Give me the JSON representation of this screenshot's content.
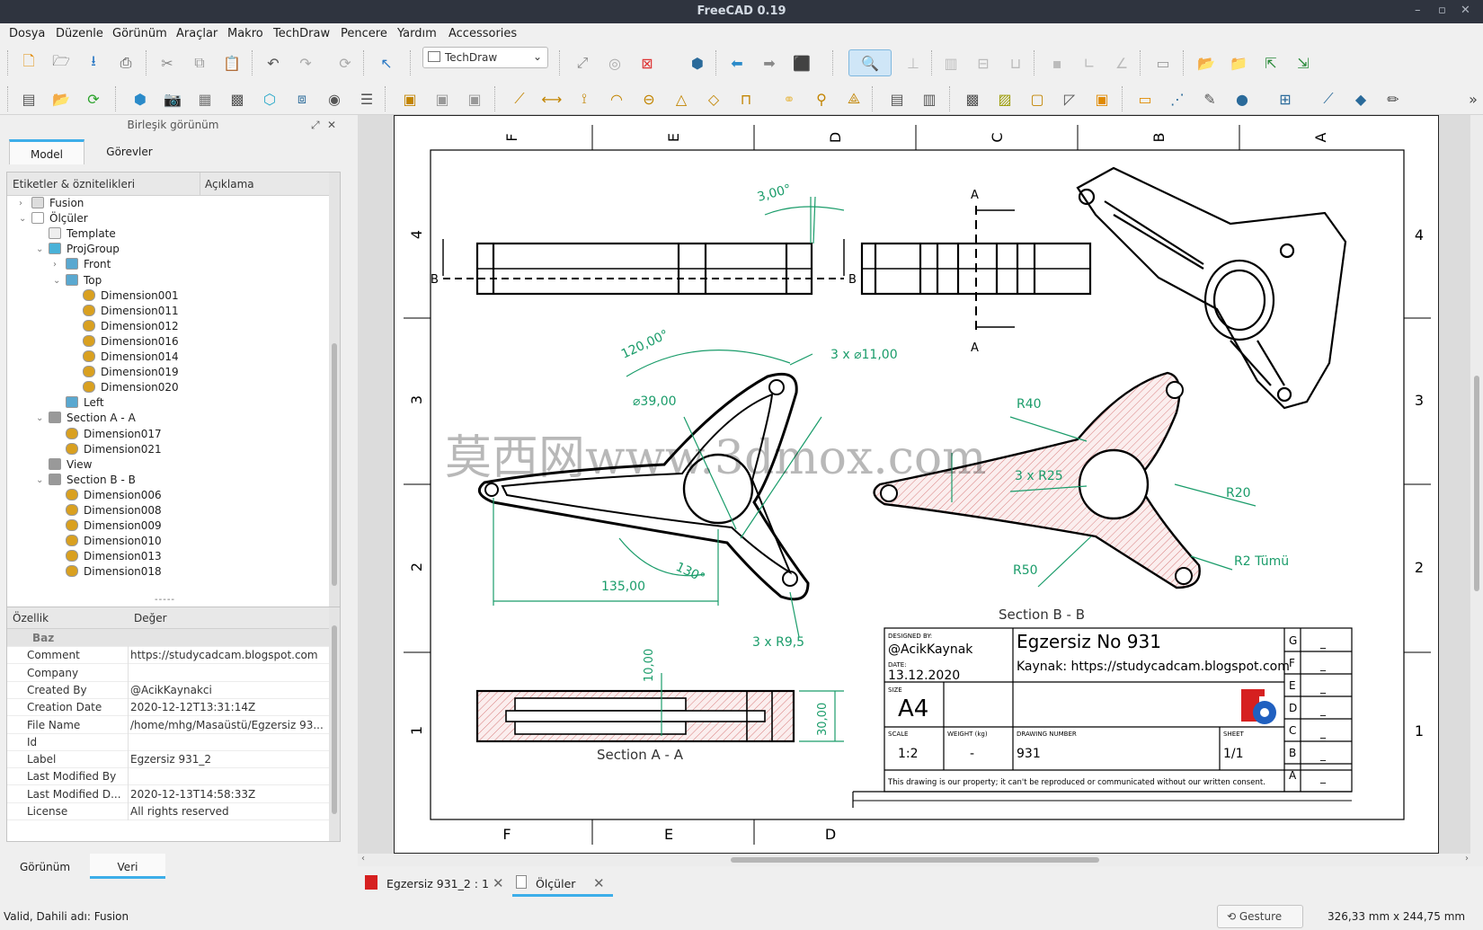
{
  "window": {
    "title": "FreeCAD 0.19",
    "controls": [
      "–",
      "▫",
      "✕"
    ]
  },
  "menu": [
    "Dosya",
    "Düzenle",
    "Görünüm",
    "Araçlar",
    "Makro",
    "TechDraw",
    "Pencere",
    "Yardım",
    "Accessories"
  ],
  "workbench": {
    "selected": "TechDraw"
  },
  "combo_view": {
    "title": "Birleşik görünüm",
    "tabs": [
      "Model",
      "Görevler"
    ],
    "active_tab": "Model",
    "tree_headers": [
      "Etiketler & öznitelikleri",
      "Açıklama"
    ],
    "tree": [
      {
        "label": "Fusion",
        "level": 1,
        "expander": "›",
        "icon": "fusion-icon"
      },
      {
        "label": "Ölçüler",
        "level": 1,
        "expander": "⌄",
        "icon": "page-icon"
      },
      {
        "label": "Template",
        "level": 2,
        "expander": "",
        "icon": "template-icon"
      },
      {
        "label": "ProjGroup",
        "level": 2,
        "expander": "⌄",
        "icon": "projgroup-icon"
      },
      {
        "label": "Front",
        "level": 3,
        "expander": "›",
        "icon": "view-icon"
      },
      {
        "label": "Top",
        "level": 3,
        "expander": "⌄",
        "icon": "view-icon"
      },
      {
        "label": "Dimension001",
        "level": 4,
        "expander": "",
        "icon": "diameter-dim-icon"
      },
      {
        "label": "Dimension011",
        "level": 4,
        "expander": "",
        "icon": "diameter-dim-icon"
      },
      {
        "label": "Dimension012",
        "level": 4,
        "expander": "",
        "icon": "radius-dim-icon"
      },
      {
        "label": "Dimension016",
        "level": 4,
        "expander": "",
        "icon": "angle-dim-icon"
      },
      {
        "label": "Dimension014",
        "level": 4,
        "expander": "",
        "icon": "horizontal-dim-icon"
      },
      {
        "label": "Dimension019",
        "level": 4,
        "expander": "",
        "icon": "length-dim-icon"
      },
      {
        "label": "Dimension020",
        "level": 4,
        "expander": "",
        "icon": "angle-dim-icon"
      },
      {
        "label": "Left",
        "level": 3,
        "expander": "",
        "icon": "view-icon"
      },
      {
        "label": "Section A - A",
        "level": 2,
        "expander": "⌄",
        "icon": "section-icon"
      },
      {
        "label": "Dimension017",
        "level": 3,
        "expander": "",
        "icon": "vertical-dim-icon"
      },
      {
        "label": "Dimension021",
        "level": 3,
        "expander": "",
        "icon": "vertical-dim-icon"
      },
      {
        "label": "View",
        "level": 2,
        "expander": "",
        "icon": "section-icon"
      },
      {
        "label": "Section B - B",
        "level": 2,
        "expander": "⌄",
        "icon": "section-icon"
      },
      {
        "label": "Dimension006",
        "level": 3,
        "expander": "",
        "icon": "radius-dim-icon"
      },
      {
        "label": "Dimension008",
        "level": 3,
        "expander": "",
        "icon": "radius-dim-icon"
      },
      {
        "label": "Dimension009",
        "level": 3,
        "expander": "",
        "icon": "radius-dim-icon"
      },
      {
        "label": "Dimension010",
        "level": 3,
        "expander": "",
        "icon": "length-dim-icon"
      },
      {
        "label": "Dimension013",
        "level": 3,
        "expander": "",
        "icon": "radius-dim-icon"
      },
      {
        "label": "Dimension018",
        "level": 3,
        "expander": "",
        "icon": "radius-dim-icon"
      }
    ],
    "splitter": "-----",
    "prop_headers": [
      "Özellik",
      "Değer"
    ],
    "properties": [
      {
        "key": "Baz",
        "value": "",
        "group": true
      },
      {
        "key": "Comment",
        "value": "https://studycadcam.blogspot.com"
      },
      {
        "key": "Company",
        "value": ""
      },
      {
        "key": "Created By",
        "value": "@AcikKaynakci"
      },
      {
        "key": "Creation Date",
        "value": "2020-12-12T13:31:14Z"
      },
      {
        "key": "File Name",
        "value": "/home/mhg/Masaüstü/Egzersiz 93..."
      },
      {
        "key": "Id",
        "value": ""
      },
      {
        "key": "Label",
        "value": "Egzersiz 931_2"
      },
      {
        "key": "Last Modified By",
        "value": ""
      },
      {
        "key": "Last Modified D...",
        "value": "2020-12-13T14:58:33Z"
      },
      {
        "key": "License",
        "value": "All rights reserved"
      }
    ],
    "bottom_tabs": [
      "Görünüm",
      "Veri"
    ],
    "active_bottom_tab": "Veri"
  },
  "drawing": {
    "zones_top": [
      "F",
      "E",
      "D",
      "C",
      "B",
      "A"
    ],
    "zones_bottom": [
      "F",
      "E",
      "D"
    ],
    "zones_left": [
      "4",
      "3",
      "2",
      "1"
    ],
    "zones_right": [
      "4",
      "3",
      "2",
      "1"
    ],
    "section_labels": {
      "a_top": "A",
      "a_bottom": "A",
      "b_left": "B",
      "b_right": "B"
    },
    "dims": {
      "angle3": "3,00°",
      "holes": "3 x ⌀11,00",
      "dia39": "⌀39,00",
      "ang120": "120,00°",
      "ang130": "130°",
      "len135": "135,00",
      "r95": "3 x R9,5",
      "r40": "R40",
      "r25": "3 x R25",
      "r20": "R20",
      "r50": "R50",
      "r2": "R2 Tümü",
      "t10": "10,00",
      "t30": "30,00"
    },
    "section_bb": "Section B - B",
    "section_aa": "Section A - A",
    "watermark": "莫西网www.3dmox.com",
    "title_block": {
      "designed_by_label": "DESIGNED BY:",
      "designed_by": "@AcikKaynak",
      "date_label": "DATE:",
      "date": "13.12.2020",
      "size_label": "SIZE",
      "size": "A4",
      "title": "Egzersiz No 931",
      "source": "Kaynak: https://studycadcam.blogspot.com",
      "scale_label": "SCALE",
      "scale": "1:2",
      "weight_label": "WEIGHT (kg)",
      "weight": "-",
      "drawing_number_label": "DRAWING NUMBER",
      "drawing_number": "931",
      "sheet_label": "SHEET",
      "sheet": "1/1",
      "revisions": [
        "G",
        "F",
        "E",
        "D",
        "C",
        "B",
        "A"
      ],
      "rev_values": [
        "_",
        "_",
        "_",
        "_",
        "_",
        "_",
        "_"
      ],
      "copyright": "This drawing is our property; it can't be reproduced or communicated without our written consent."
    }
  },
  "doc_tabs": [
    {
      "label": "Egzersiz 931_2 : 1",
      "active": false
    },
    {
      "label": "Ölçüler",
      "active": true
    }
  ],
  "status": {
    "left": "Valid, Dahili adı: Fusion",
    "nav_style": "Gesture",
    "dimensions": "326,33 mm x 244,75 mm"
  },
  "colors": {
    "dimension": "#1a9c6a",
    "selection_tab": "#3daee9",
    "hatch": "#d98080"
  }
}
